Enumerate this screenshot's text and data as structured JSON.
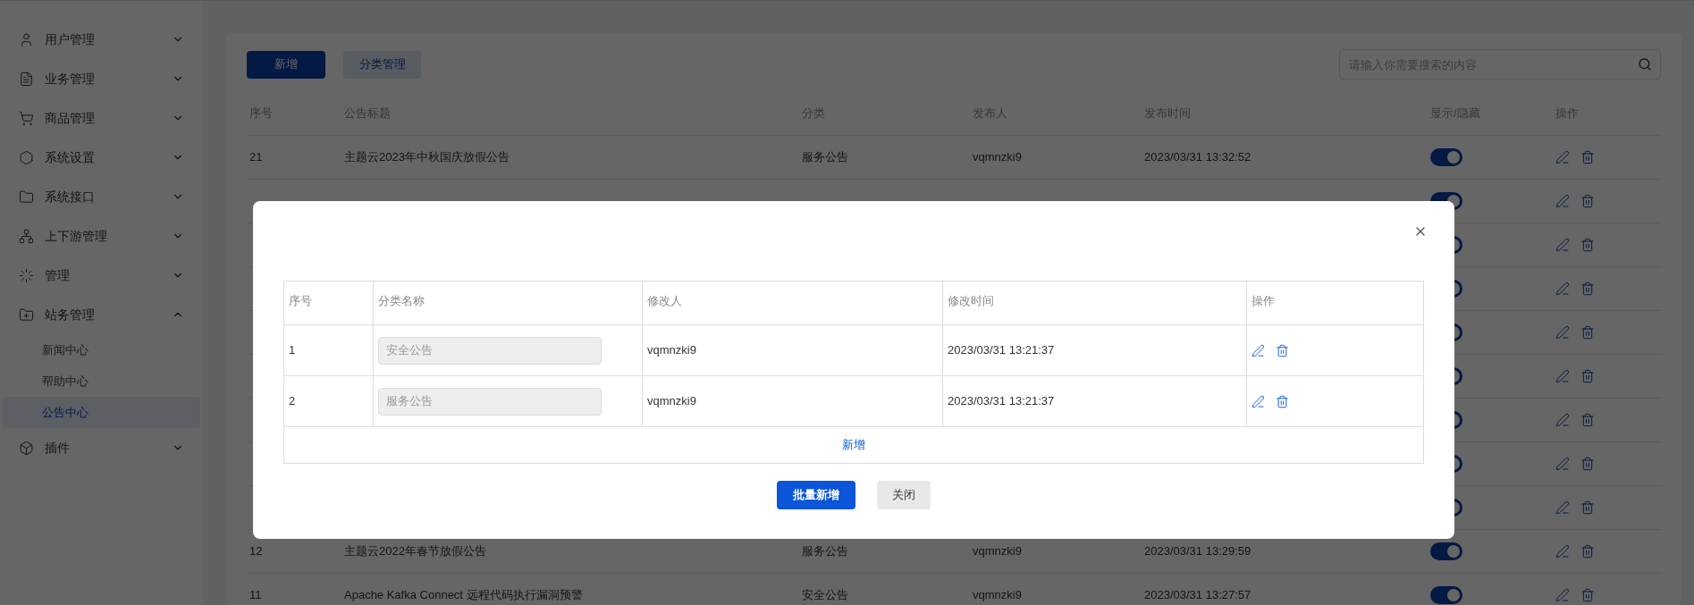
{
  "sidebar": {
    "items": [
      {
        "label": "用户管理",
        "expanded": false
      },
      {
        "label": "业务管理",
        "expanded": false
      },
      {
        "label": "商品管理",
        "expanded": false
      },
      {
        "label": "系统设置",
        "expanded": false
      },
      {
        "label": "系统接口",
        "expanded": false
      },
      {
        "label": "上下游管理",
        "expanded": false
      },
      {
        "label": "管理",
        "expanded": false
      },
      {
        "label": "站务管理",
        "expanded": true,
        "children": [
          {
            "label": "新闻中心",
            "selected": false
          },
          {
            "label": "帮助中心",
            "selected": false
          },
          {
            "label": "公告中心",
            "selected": true
          }
        ]
      },
      {
        "label": "插件",
        "expanded": false
      }
    ]
  },
  "toolbar": {
    "add_button": "新增",
    "category_button": "分类管理",
    "search": {
      "placeholder": "请输入你需要搜索的内容"
    }
  },
  "table": {
    "columns": [
      "序号",
      "公告标题",
      "分类",
      "发布人",
      "发布时间",
      "显示/隐藏",
      "操作"
    ],
    "rows": [
      {
        "index": "21",
        "title": "主题云2023年中秋国庆放假公告",
        "category": "服务公告",
        "publisher": "vqmnzki9",
        "time": "2023/03/31 13:32:52",
        "shown": true
      },
      {
        "shown": true
      },
      {
        "shown": true
      },
      {
        "shown": true
      },
      {
        "shown": true
      },
      {
        "shown": true
      },
      {
        "shown": true
      },
      {
        "shown": true
      },
      {
        "shown": true
      },
      {
        "index": "12",
        "title": "主题云2022年春节放假公告",
        "category": "服务公告",
        "publisher": "vqmnzki9",
        "time": "2023/03/31 13:29:59",
        "shown": true
      },
      {
        "index": "11",
        "title": "Apache Kafka Connect 远程代码执行漏洞预警",
        "category": "安全公告",
        "publisher": "vqmnzki9",
        "time": "2023/03/31 13:27:57",
        "shown": true
      }
    ]
  },
  "dialog": {
    "table": {
      "columns": [
        "序号",
        "分类名称",
        "修改人",
        "修改时间",
        "操作"
      ],
      "rows": [
        {
          "index": "1",
          "name": "安全公告",
          "disabled": true,
          "editor": "vqmnzki9",
          "time": "2023/03/31 13:21:37"
        },
        {
          "index": "2",
          "name": "服务公告",
          "disabled": true,
          "editor": "vqmnzki9",
          "time": "2023/03/31 13:21:37"
        }
      ],
      "add_row": "新增"
    },
    "batch_add_button": "批量新增",
    "close_button": "关闭"
  }
}
